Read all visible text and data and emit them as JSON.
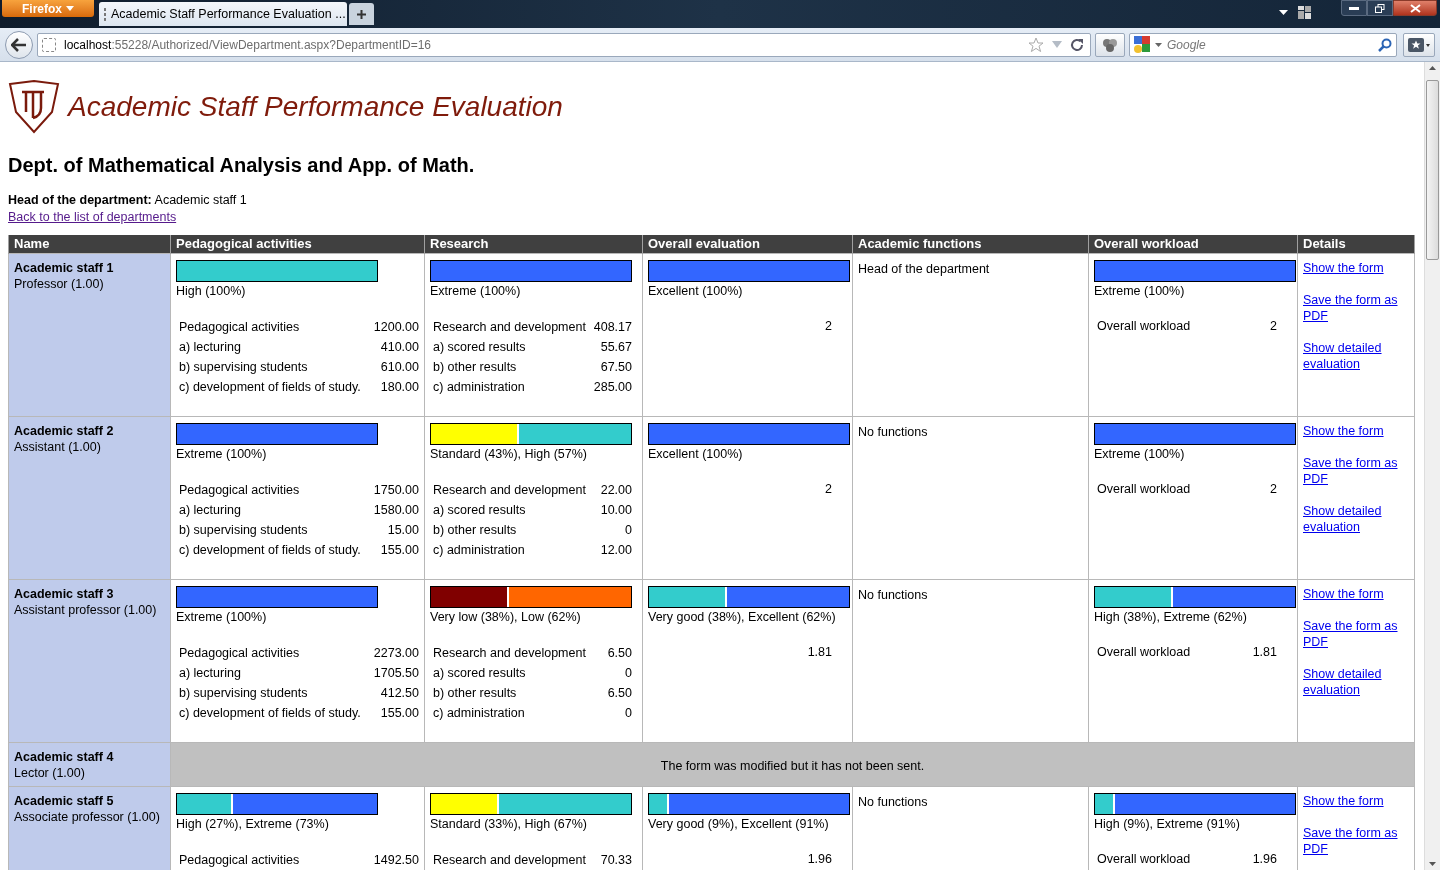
{
  "browser": {
    "app_button": "Firefox",
    "tab_title": "Academic Staff Performance Evaluation ...",
    "url_host": "localhost",
    "url_path": ":55228/Authorized/ViewDepartment.aspx?DepartmentID=16",
    "search_placeholder": "Google"
  },
  "header": {
    "title": "Academic Staff Performance Evaluation"
  },
  "department": {
    "name": "Dept. of Mathematical Analysis and App. of Math.",
    "head_label": "Head of the department:",
    "head_value": "Academic staff 1",
    "back_link": "Back to the list of departments"
  },
  "table": {
    "columns": [
      "Name",
      "Pedagogical activities",
      "Research",
      "Overall evaluation",
      "Academic functions",
      "Overall workload",
      "Details"
    ],
    "rows": [
      {
        "kind": "evaluated",
        "name": "Academic staff 1",
        "position": "Professor (1.00)",
        "pedagogical": {
          "bar": [
            {
              "color": "#33cccc",
              "level": 1
            }
          ],
          "rating": "High (100%)",
          "items": [
            {
              "label": "Pedagogical activities",
              "value": "1200.00"
            },
            {
              "label": "a) lecturing",
              "value": "410.00"
            },
            {
              "label": "b) supervising students",
              "value": "610.00"
            },
            {
              "label": "c) development of fields of study.",
              "value": "180.00"
            }
          ]
        },
        "research": {
          "bar": [
            {
              "color": "#3366ff",
              "level": 1
            }
          ],
          "rating": "Extreme (100%)",
          "items": [
            {
              "label": "Research and development",
              "value": "408.17"
            },
            {
              "label": "a) scored results",
              "value": "55.67"
            },
            {
              "label": "b) other results",
              "value": "67.50"
            },
            {
              "label": "c) administration",
              "value": "285.00"
            }
          ]
        },
        "evaluation": {
          "bar": [
            {
              "color": "#3366ff",
              "level": 1
            }
          ],
          "rating": "Excellent (100%)",
          "score": "2"
        },
        "functions": "Head of the department",
        "workload": {
          "bar": [
            {
              "color": "#3366ff",
              "level": 1
            }
          ],
          "rating": "Extreme (100%)",
          "label": "Overall workload",
          "value": "2"
        },
        "links": [
          "Show the form",
          "Save the form as PDF",
          "Show detailed evaluation"
        ]
      },
      {
        "kind": "evaluated",
        "name": "Academic staff 2",
        "position": "Assistant (1.00)",
        "pedagogical": {
          "bar": [
            {
              "color": "#3366ff",
              "level": 1
            }
          ],
          "rating": "Extreme (100%)",
          "items": [
            {
              "label": "Pedagogical activities",
              "value": "1750.00"
            },
            {
              "label": "a) lecturing",
              "value": "1580.00"
            },
            {
              "label": "b) supervising students",
              "value": "15.00"
            },
            {
              "label": "c) development of fields of study.",
              "value": "155.00"
            }
          ]
        },
        "research": {
          "bar": [
            {
              "color": "#ffff00",
              "level": 0.43
            },
            {
              "color": "#33cccc",
              "level": 0.57
            }
          ],
          "rating": "Standard (43%), High (57%)",
          "items": [
            {
              "label": "Research and development",
              "value": "22.00"
            },
            {
              "label": "a) scored results",
              "value": "10.00"
            },
            {
              "label": "b) other results",
              "value": "0"
            },
            {
              "label": "c) administration",
              "value": "12.00"
            }
          ]
        },
        "evaluation": {
          "bar": [
            {
              "color": "#3366ff",
              "level": 1
            }
          ],
          "rating": "Excellent (100%)",
          "score": "2"
        },
        "functions": "No functions",
        "workload": {
          "bar": [
            {
              "color": "#3366ff",
              "level": 1
            }
          ],
          "rating": "Extreme (100%)",
          "label": "Overall workload",
          "value": "2"
        },
        "links": [
          "Show the form",
          "Save the form as PDF",
          "Show detailed evaluation"
        ]
      },
      {
        "kind": "evaluated",
        "name": "Academic staff 3",
        "position": "Assistant professor (1.00)",
        "pedagogical": {
          "bar": [
            {
              "color": "#3366ff",
              "level": 1
            }
          ],
          "rating": "Extreme (100%)",
          "items": [
            {
              "label": "Pedagogical activities",
              "value": "2273.00"
            },
            {
              "label": "a) lecturing",
              "value": "1705.50"
            },
            {
              "label": "b) supervising students",
              "value": "412.50"
            },
            {
              "label": "c) development of fields of study.",
              "value": "155.00"
            }
          ]
        },
        "research": {
          "bar": [
            {
              "color": "#800000",
              "level": 0.38
            },
            {
              "color": "#ff6600",
              "level": 0.62
            }
          ],
          "rating": "Very low (38%), Low (62%)",
          "items": [
            {
              "label": "Research and development",
              "value": "6.50"
            },
            {
              "label": "a) scored results",
              "value": "0"
            },
            {
              "label": "b) other results",
              "value": "6.50"
            },
            {
              "label": "c) administration",
              "value": "0"
            }
          ]
        },
        "evaluation": {
          "bar": [
            {
              "color": "#33cccc",
              "level": 0.38
            },
            {
              "color": "#3366ff",
              "level": 0.62
            }
          ],
          "rating": "Very good (38%), Excellent (62%)",
          "score": "1.81"
        },
        "functions": "No functions",
        "workload": {
          "bar": [
            {
              "color": "#33cccc",
              "level": 0.38
            },
            {
              "color": "#3366ff",
              "level": 0.62
            }
          ],
          "rating": "High (38%), Extreme (62%)",
          "label": "Overall workload",
          "value": "1.81"
        },
        "links": [
          "Show the form",
          "Save the form as PDF",
          "Show detailed evaluation"
        ]
      },
      {
        "kind": "message",
        "name": "Academic staff 4",
        "position": "Lector (1.00)",
        "message": "The form was modified but it has not been sent."
      },
      {
        "kind": "evaluated",
        "name": "Academic staff 5",
        "position": "Associate professor (1.00)",
        "pedagogical": {
          "bar": [
            {
              "color": "#33cccc",
              "level": 0.27
            },
            {
              "color": "#3366ff",
              "level": 0.73
            }
          ],
          "rating": "High (27%), Extreme (73%)",
          "items": [
            {
              "label": "Pedagogical activities",
              "value": "1492.50"
            }
          ]
        },
        "research": {
          "bar": [
            {
              "color": "#ffff00",
              "level": 0.33
            },
            {
              "color": "#33cccc",
              "level": 0.67
            }
          ],
          "rating": "Standard (33%), High (67%)",
          "items": [
            {
              "label": "Research and development",
              "value": "70.33"
            }
          ]
        },
        "evaluation": {
          "bar": [
            {
              "color": "#33cccc",
              "level": 0.09
            },
            {
              "color": "#3366ff",
              "level": 0.91
            }
          ],
          "rating": "Very good (9%), Excellent (91%)",
          "score": "1.96"
        },
        "functions": "No functions",
        "workload": {
          "bar": [
            {
              "color": "#33cccc",
              "level": 0.09
            },
            {
              "color": "#3366ff",
              "level": 0.91
            }
          ],
          "rating": "High (9%), Extreme (91%)",
          "label": "Overall workload",
          "value": "1.96"
        },
        "links": [
          "Show the form",
          "Save the form as PDF"
        ]
      }
    ]
  }
}
